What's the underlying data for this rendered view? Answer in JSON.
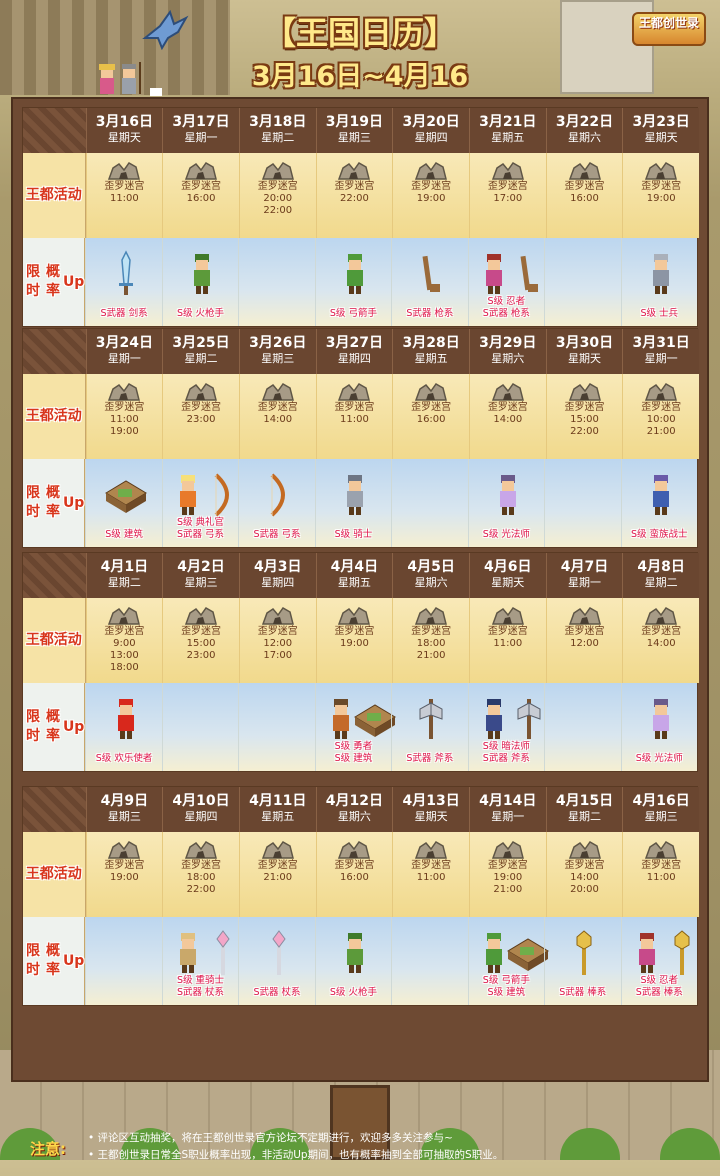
{
  "header": {
    "title": "【王国日历】",
    "subtitle": "3月16日~4月16日",
    "logo_text": "王都创世录"
  },
  "labels": {
    "event": [
      "王都",
      "活动"
    ],
    "up": [
      "限时",
      "概率",
      "Up"
    ]
  },
  "weeks": [
    {
      "days": [
        {
          "date": "3月16日",
          "weekday": "星期天",
          "event": "歪罗迷宫",
          "times": [
            "11:00"
          ],
          "up": [
            "S武器 剑系"
          ],
          "sprites": [
            "sword"
          ]
        },
        {
          "date": "3月17日",
          "weekday": "星期一",
          "event": "歪罗迷宫",
          "times": [
            "16:00"
          ],
          "up": [
            "S级 火枪手"
          ],
          "sprites": [
            "hero-green"
          ]
        },
        {
          "date": "3月18日",
          "weekday": "星期二",
          "event": "歪罗迷宫",
          "times": [
            "20:00",
            "22:00"
          ],
          "up": [],
          "sprites": []
        },
        {
          "date": "3月19日",
          "weekday": "星期三",
          "event": "歪罗迷宫",
          "times": [
            "22:00"
          ],
          "up": [
            "S级 弓箭手"
          ],
          "sprites": [
            "archer"
          ]
        },
        {
          "date": "3月20日",
          "weekday": "星期四",
          "event": "歪罗迷宫",
          "times": [
            "19:00"
          ],
          "up": [
            "S武器 枪系"
          ],
          "sprites": [
            "spear"
          ]
        },
        {
          "date": "3月21日",
          "weekday": "星期五",
          "event": "歪罗迷宫",
          "times": [
            "17:00"
          ],
          "up": [
            "S级 忍者",
            "S武器 枪系"
          ],
          "sprites": [
            "ninja",
            "spear"
          ]
        },
        {
          "date": "3月22日",
          "weekday": "星期六",
          "event": "歪罗迷宫",
          "times": [
            "16:00"
          ],
          "up": [],
          "sprites": []
        },
        {
          "date": "3月23日",
          "weekday": "星期天",
          "event": "歪罗迷宫",
          "times": [
            "19:00"
          ],
          "up": [
            "S级 士兵"
          ],
          "sprites": [
            "soldier"
          ]
        }
      ]
    },
    {
      "days": [
        {
          "date": "3月24日",
          "weekday": "星期一",
          "event": "歪罗迷宫",
          "times": [
            "11:00",
            "19:00"
          ],
          "up": [
            "S级 建筑"
          ],
          "sprites": [
            "building"
          ]
        },
        {
          "date": "3月25日",
          "weekday": "星期二",
          "event": "歪罗迷宫",
          "times": [
            "23:00"
          ],
          "up": [
            "S级 典礼官",
            "S武器 弓系"
          ],
          "sprites": [
            "priest",
            "bow"
          ]
        },
        {
          "date": "3月26日",
          "weekday": "星期三",
          "event": "歪罗迷宫",
          "times": [
            "14:00"
          ],
          "up": [
            "S武器 弓系"
          ],
          "sprites": [
            "bow"
          ]
        },
        {
          "date": "3月27日",
          "weekday": "星期四",
          "event": "歪罗迷宫",
          "times": [
            "11:00"
          ],
          "up": [
            "S级 骑士"
          ],
          "sprites": [
            "knight"
          ]
        },
        {
          "date": "3月28日",
          "weekday": "星期五",
          "event": "歪罗迷宫",
          "times": [
            "16:00"
          ],
          "up": [],
          "sprites": []
        },
        {
          "date": "3月29日",
          "weekday": "星期六",
          "event": "歪罗迷宫",
          "times": [
            "14:00"
          ],
          "up": [
            "S级 光法师"
          ],
          "sprites": [
            "mage"
          ]
        },
        {
          "date": "3月30日",
          "weekday": "星期天",
          "event": "歪罗迷宫",
          "times": [
            "15:00",
            "22:00"
          ],
          "up": [],
          "sprites": []
        },
        {
          "date": "3月31日",
          "weekday": "星期一",
          "event": "歪罗迷宫",
          "times": [
            "10:00",
            "21:00"
          ],
          "up": [
            "S级 蛮族战士"
          ],
          "sprites": [
            "viking"
          ]
        }
      ]
    },
    {
      "days": [
        {
          "date": "4月1日",
          "weekday": "星期二",
          "event": "歪罗迷宫",
          "times": [
            "9:00",
            "13:00",
            "18:00"
          ],
          "up": [
            "S级 欢乐使者"
          ],
          "sprites": [
            "santa"
          ]
        },
        {
          "date": "4月2日",
          "weekday": "星期三",
          "event": "歪罗迷宫",
          "times": [
            "15:00",
            "23:00"
          ],
          "up": [],
          "sprites": []
        },
        {
          "date": "4月3日",
          "weekday": "星期四",
          "event": "歪罗迷宫",
          "times": [
            "12:00",
            "17:00"
          ],
          "up": [],
          "sprites": []
        },
        {
          "date": "4月4日",
          "weekday": "星期五",
          "event": "歪罗迷宫",
          "times": [
            "19:00"
          ],
          "up": [
            "S级 勇者",
            "S级 建筑"
          ],
          "sprites": [
            "hero",
            "building"
          ]
        },
        {
          "date": "4月5日",
          "weekday": "星期六",
          "event": "歪罗迷宫",
          "times": [
            "18:00",
            "21:00"
          ],
          "up": [
            "S武器 斧系"
          ],
          "sprites": [
            "axe"
          ]
        },
        {
          "date": "4月6日",
          "weekday": "星期天",
          "event": "歪罗迷宫",
          "times": [
            "11:00"
          ],
          "up": [
            "S级 暗法师",
            "S武器 斧系"
          ],
          "sprites": [
            "darkmage",
            "axe"
          ]
        },
        {
          "date": "4月7日",
          "weekday": "星期一",
          "event": "歪罗迷宫",
          "times": [
            "12:00"
          ],
          "up": [],
          "sprites": []
        },
        {
          "date": "4月8日",
          "weekday": "星期二",
          "event": "歪罗迷宫",
          "times": [
            "14:00"
          ],
          "up": [
            "S级 光法师"
          ],
          "sprites": [
            "mage"
          ]
        }
      ]
    },
    {
      "days": [
        {
          "date": "4月9日",
          "weekday": "星期三",
          "event": "歪罗迷宫",
          "times": [
            "19:00"
          ],
          "up": [],
          "sprites": []
        },
        {
          "date": "4月10日",
          "weekday": "星期四",
          "event": "歪罗迷宫",
          "times": [
            "18:00",
            "22:00"
          ],
          "up": [
            "S级 重骑士",
            "S武器 杖系"
          ],
          "sprites": [
            "heavyknight",
            "staff"
          ]
        },
        {
          "date": "4月11日",
          "weekday": "星期五",
          "event": "歪罗迷宫",
          "times": [
            "21:00"
          ],
          "up": [
            "S武器 杖系"
          ],
          "sprites": [
            "staff"
          ]
        },
        {
          "date": "4月12日",
          "weekday": "星期六",
          "event": "歪罗迷宫",
          "times": [
            "16:00"
          ],
          "up": [
            "S级 火枪手"
          ],
          "sprites": [
            "hero-green"
          ]
        },
        {
          "date": "4月13日",
          "weekday": "星期天",
          "event": "歪罗迷宫",
          "times": [
            "11:00"
          ],
          "up": [],
          "sprites": []
        },
        {
          "date": "4月14日",
          "weekday": "星期一",
          "event": "歪罗迷宫",
          "times": [
            "19:00",
            "21:00"
          ],
          "up": [
            "S级 弓箭手",
            "S级 建筑"
          ],
          "sprites": [
            "archer",
            "building"
          ]
        },
        {
          "date": "4月15日",
          "weekday": "星期二",
          "event": "歪罗迷宫",
          "times": [
            "14:00",
            "20:00"
          ],
          "up": [
            "S武器 棒系"
          ],
          "sprites": [
            "mace"
          ]
        },
        {
          "date": "4月16日",
          "weekday": "星期三",
          "event": "歪罗迷宫",
          "times": [
            "11:00"
          ],
          "up": [
            "S级 忍者",
            "S武器 棒系"
          ],
          "sprites": [
            "ninja",
            "mace"
          ]
        }
      ]
    }
  ],
  "notes": {
    "label": "注意:",
    "items": [
      "• 评论区互动抽奖，将在王都创世录官方论坛不定期进行，欢迎多多关注参与~",
      "• 王都创世录日常全S职业概率出现，非活动Up期间，也有概率抽到全部可抽取的S职业。"
    ]
  },
  "colors": {
    "board": "#6e4a33",
    "header_row": "#6a4630",
    "event_bg": "#f1d98c",
    "up_bg": "#bcd6ef",
    "label_red": "#d8361c",
    "up_text": "#e0144a",
    "title_yellow": "#ffe98a"
  }
}
